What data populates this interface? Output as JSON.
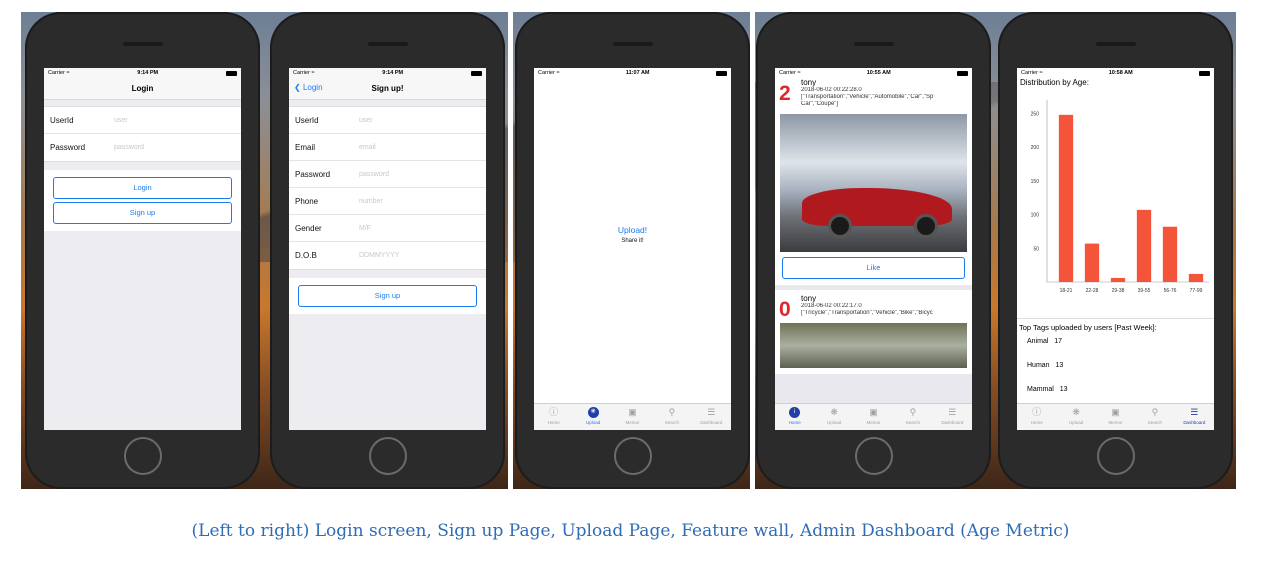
{
  "caption": "(Left to right) Login screen, Sign up Page, Upload Page, Feature wall, Admin Dashboard (Age Metric)",
  "status": {
    "carrier": "Carrier",
    "wifi_icon": "wifi-icon",
    "battery_icon": "battery-icon",
    "times": [
      "9:14 PM",
      "9:14 PM",
      "11:07 AM",
      "10:55 AM",
      "10:58 AM"
    ]
  },
  "login": {
    "title": "Login",
    "fields": [
      {
        "label": "UserId",
        "placeholder": "user"
      },
      {
        "label": "Password",
        "placeholder": "password"
      }
    ],
    "login_button": "Login",
    "signup_button": "Sign up"
  },
  "signup": {
    "back_label": "Login",
    "title": "Sign up!",
    "fields": [
      {
        "label": "UserId",
        "placeholder": "user"
      },
      {
        "label": "Email",
        "placeholder": "email"
      },
      {
        "label": "Password",
        "placeholder": "password"
      },
      {
        "label": "Phone",
        "placeholder": "number"
      },
      {
        "label": "Gender",
        "placeholder": "M/F"
      },
      {
        "label": "D.O.B",
        "placeholder": "DDMMYYYY"
      }
    ],
    "signup_button": "Sign up"
  },
  "upload": {
    "upload_link": "Upload!",
    "share_text": "Share it!"
  },
  "tabs": [
    {
      "label": "Home",
      "icon": "info-icon"
    },
    {
      "label": "Upload",
      "icon": "aperture-icon"
    },
    {
      "label": "Memor",
      "icon": "memo-icon"
    },
    {
      "label": "Search",
      "icon": "search-icon"
    },
    {
      "label": "Dashboard",
      "icon": "sliders-icon"
    }
  ],
  "feed": {
    "posts": [
      {
        "likes": "2",
        "user": "tony",
        "timestamp": "2018-06-02 00:22:28.0",
        "tags_line1": "[\"Transportation\",\"Vehicle\",\"Automobile\",\"Car\",\"Sp",
        "tags_line2": "Car\",\"Coupe\"]"
      },
      {
        "likes": "0",
        "user": "tony",
        "timestamp": "2018-06-02 00:22:17.0",
        "tags_line1": "[\"Tricycle\",\"Transportation\",\"Vehicle\",\"Bike\",\"Bicyc",
        "tags_line2": ""
      }
    ],
    "like_button": "Like"
  },
  "dashboard": {
    "title": "Distribution by Age:",
    "tags_title": "Top Tags uploaded by users [Past Week]:",
    "top_tags": [
      {
        "tag": "Animal",
        "count": "17"
      },
      {
        "tag": "Human",
        "count": "13"
      },
      {
        "tag": "Mammal",
        "count": "13"
      }
    ]
  },
  "chart_data": {
    "type": "bar",
    "title": "Distribution by Age:",
    "categories": [
      "18-21",
      "22-28",
      "29-38",
      "39-55",
      "56-76",
      "77-99"
    ],
    "values": [
      248,
      57,
      6,
      107,
      82,
      12
    ],
    "yticks": [
      50,
      100,
      150,
      200,
      250
    ],
    "ylim": [
      0,
      270
    ],
    "bar_color": "#f4553a",
    "grid": false
  },
  "colors": {
    "accent": "#1b7cf0",
    "like_count": "#e0262b",
    "active_tab_icon": "#1f3ea8"
  }
}
